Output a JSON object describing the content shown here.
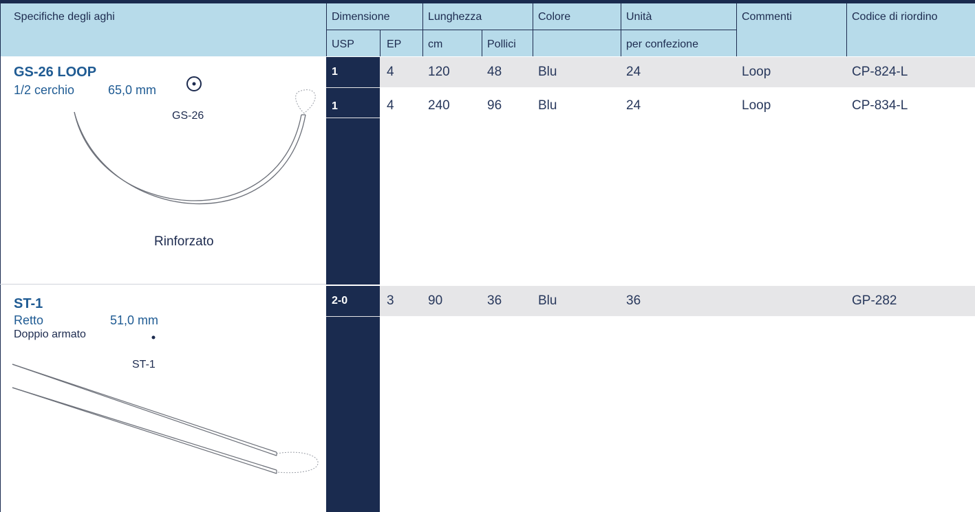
{
  "header": {
    "specs": "Specifiche degli aghi",
    "size": "Dimensione",
    "usp": "USP",
    "ep": "EP",
    "length": "Lunghezza",
    "cm": "cm",
    "inches": "Pollici",
    "color": "Colore",
    "units": "Unità",
    "units_sub": "per confezione",
    "comments": "Commenti",
    "reorder": "Codice di riordino"
  },
  "needles": [
    {
      "title": "GS-26 LOOP",
      "shape": "1/2 cerchio",
      "size": "65,0 mm",
      "label": "GS-26",
      "caption": "Rinforzato",
      "icon": "circle-dot-icon"
    },
    {
      "title": "ST-1",
      "shape": "Retto",
      "size": "51,0 mm",
      "extra": "Doppio armato",
      "label": "ST-1",
      "icon": "dot-icon"
    }
  ],
  "rows": [
    {
      "usp": "1",
      "ep": "4",
      "cm": "120",
      "inches": "48",
      "color": "Blu",
      "units": "24",
      "comment": "Loop",
      "code": "CP-824-L"
    },
    {
      "usp": "1",
      "ep": "4",
      "cm": "240",
      "inches": "96",
      "color": "Blu",
      "units": "24",
      "comment": "Loop",
      "code": "CP-834-L"
    },
    {
      "usp": "2-0",
      "ep": "3",
      "cm": "90",
      "inches": "36",
      "color": "Blu",
      "units": "36",
      "comment": "",
      "code": "GP-282"
    }
  ],
  "colors": {
    "navy": "#1a2b4f",
    "header_bg": "#b7dbea",
    "row_bg": "#e6e6e8",
    "title_blue": "#1f5b93"
  }
}
